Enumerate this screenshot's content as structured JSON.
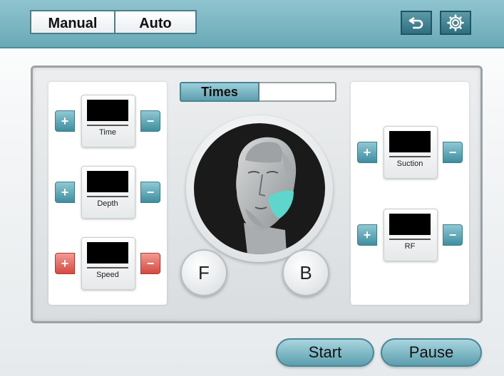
{
  "header": {
    "modes": {
      "manual": "Manual",
      "auto": "Auto"
    },
    "back_icon": "return-arrow-icon",
    "settings_icon": "gear-icon"
  },
  "controls_left": [
    {
      "label": "Time",
      "plus": "+",
      "minus": "−"
    },
    {
      "label": "Depth",
      "plus": "+",
      "minus": "−"
    },
    {
      "label": "Speed",
      "plus": "+",
      "minus": "−"
    }
  ],
  "controls_right": [
    {
      "label": "Suction",
      "plus": "+",
      "minus": "−"
    },
    {
      "label": "RF",
      "plus": "+",
      "minus": "−"
    }
  ],
  "times": {
    "label": "Times",
    "value": ""
  },
  "face": {
    "f_label": "F",
    "b_label": "B"
  },
  "actions": {
    "start": "Start",
    "pause": "Pause"
  },
  "colors": {
    "accent": "#6aa9b7",
    "speed_accent": "#d54a40",
    "treatment_area": "#5fd6cc"
  }
}
